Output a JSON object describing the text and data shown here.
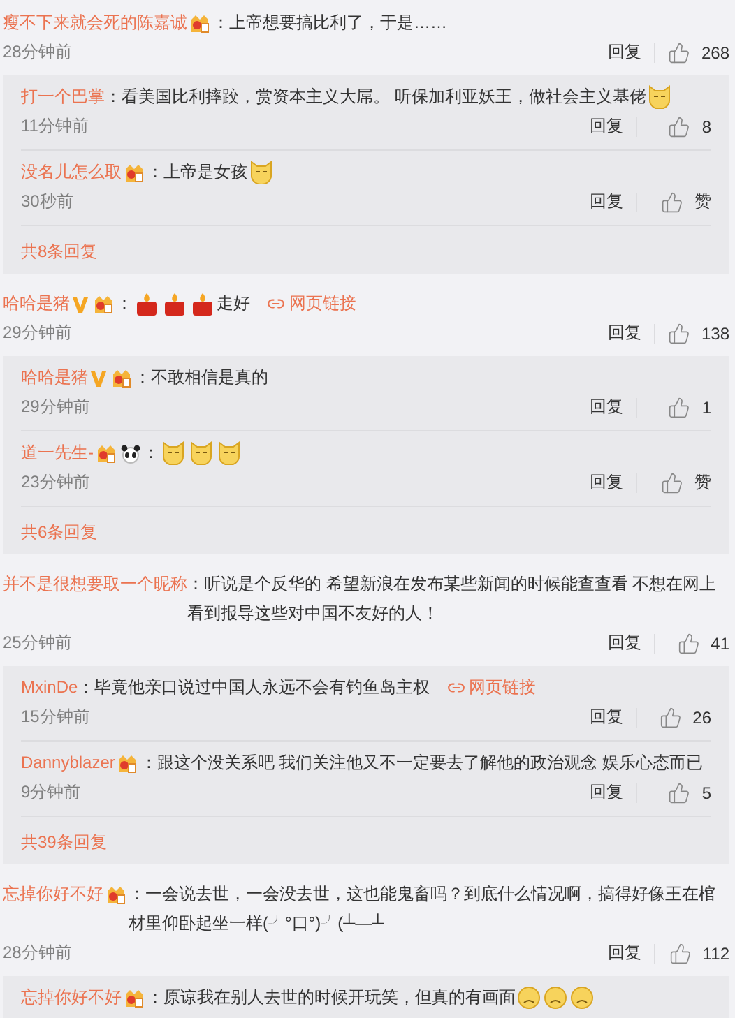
{
  "comments": [
    {
      "user": "瘦不下来就会死的陈嘉诚",
      "badges": [
        {
          "kind": "member"
        }
      ],
      "content": [
        {
          "kind": "text",
          "text": "：上帝想要搞比利了，于是……"
        }
      ],
      "time": "28分钟前",
      "reply": "回复",
      "likes": "268",
      "replies": [
        {
          "user": "打一个巴掌",
          "content": [
            {
              "kind": "text",
              "text": "：看美国比利摔跤，赏资本主义大屌。 听保加利亚妖王，做社会主义基佬"
            },
            {
              "kind": "doge"
            }
          ],
          "time": "11分钟前",
          "reply": "回复",
          "likes": "8"
        },
        {
          "user": "没名儿怎么取",
          "badges": [
            {
              "kind": "member"
            }
          ],
          "content": [
            {
              "kind": "text",
              "text": "：上帝是女孩"
            },
            {
              "kind": "doge"
            }
          ],
          "time": "30秒前",
          "reply": "回复",
          "likes": "赞"
        }
      ],
      "more": "共8条回复"
    },
    {
      "user": "哈哈是猪",
      "badges": [
        {
          "kind": "verified"
        },
        {
          "kind": "member"
        }
      ],
      "content": [
        {
          "kind": "text",
          "text": "："
        },
        {
          "kind": "candle"
        },
        {
          "kind": "candle"
        },
        {
          "kind": "candle"
        },
        {
          "kind": "text",
          "text": "走好"
        },
        {
          "kind": "link",
          "text": "网页链接"
        }
      ],
      "time": "29分钟前",
      "reply": "回复",
      "likes": "138",
      "replies": [
        {
          "user": "哈哈是猪",
          "badges": [
            {
              "kind": "verified"
            },
            {
              "kind": "member"
            }
          ],
          "content": [
            {
              "kind": "text",
              "text": "：不敢相信是真的"
            }
          ],
          "time": "29分钟前",
          "reply": "回复",
          "likes": "1"
        },
        {
          "user": "道一先生-",
          "badges": [
            {
              "kind": "member"
            },
            {
              "kind": "panda"
            }
          ],
          "content": [
            {
              "kind": "text",
              "text": "："
            },
            {
              "kind": "doge"
            },
            {
              "kind": "doge"
            },
            {
              "kind": "doge"
            }
          ],
          "time": "23分钟前",
          "reply": "回复",
          "likes": "赞"
        }
      ],
      "more": "共6条回复"
    },
    {
      "user": "并不是很想要取一个昵称",
      "content": [
        {
          "kind": "text",
          "text": "：听说是个反华的 希望新浪在发布某些新闻的时候能查查看 不想在网上看到报导这些对中国不友好的人！"
        }
      ],
      "time": "25分钟前",
      "reply": "回复",
      "likes": "41",
      "replies": [
        {
          "user": "MxinDe",
          "content": [
            {
              "kind": "text",
              "text": "：毕竟他亲口说过中国人永远不会有钓鱼岛主权"
            },
            {
              "kind": "link",
              "text": "网页链接"
            }
          ],
          "time": "15分钟前",
          "reply": "回复",
          "likes": "26"
        },
        {
          "user": "Dannyblazer",
          "badges": [
            {
              "kind": "member"
            }
          ],
          "content": [
            {
              "kind": "text",
              "text": "：跟这个没关系吧 我们关注他又不一定要去了解他的政治观念 娱乐心态而已"
            }
          ],
          "time": "9分钟前",
          "reply": "回复",
          "likes": "5"
        }
      ],
      "more": "共39条回复"
    },
    {
      "user": "忘掉你好不好",
      "badges": [
        {
          "kind": "member"
        }
      ],
      "content": [
        {
          "kind": "text",
          "text": "：一会说去世，一会没去世，这也能鬼畜吗？到底什么情况啊，搞得好像王在棺材里仰卧起坐一样(╯°口°)╯(┴—┴"
        }
      ],
      "time": "28分钟前",
      "reply": "回复",
      "likes": "112",
      "replies": [
        {
          "user": "忘掉你好不好",
          "badges": [
            {
              "kind": "member"
            }
          ],
          "content": [
            {
              "kind": "text",
              "text": "：原谅我在别人去世的时候开玩笑，但真的有画面"
            },
            {
              "kind": "sad"
            },
            {
              "kind": "sad"
            },
            {
              "kind": "sad"
            }
          ]
        }
      ]
    }
  ]
}
